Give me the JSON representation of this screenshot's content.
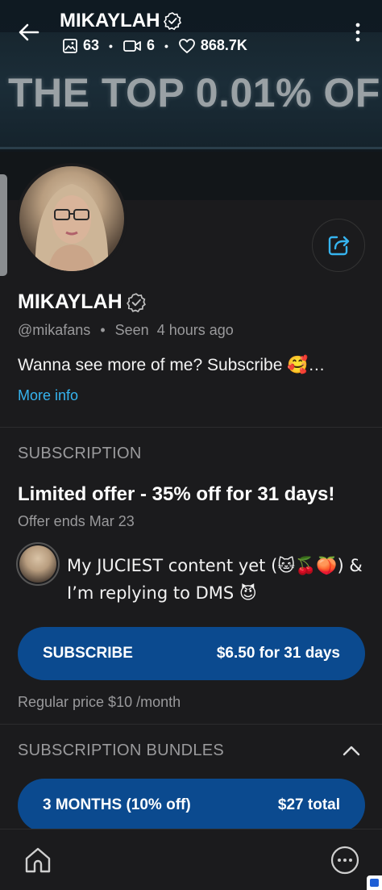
{
  "header": {
    "title": "MIKAYLAH",
    "stats": {
      "photos": "63",
      "videos": "6",
      "likes": "868.7K"
    },
    "cover_text": "THE TOP 0.01% OF"
  },
  "profile": {
    "name": "MIKAYLAH",
    "handle": "@mikafans",
    "seen_label": "Seen",
    "seen_time": "4 hours ago",
    "bio": "Wanna see more of me? Subscribe 🥰…",
    "more_info": "More info"
  },
  "subscription": {
    "section_title": "SUBSCRIPTION",
    "offer_title": "Limited offer - 35% off for 31 days!",
    "offer_ends": "Offer ends Mar 23",
    "message": "My JUCIEST content yet (🐱🍒🍑) & I’m replying to DMS 😈",
    "subscribe_label": "SUBSCRIBE",
    "subscribe_price": "$6.50 for 31 days",
    "regular_price": "Regular price $10 /month"
  },
  "bundles": {
    "section_title": "SUBSCRIPTION BUNDLES",
    "items": [
      {
        "label": "3 MONTHS (10% off)",
        "price": "$27 total"
      }
    ]
  },
  "colors": {
    "accent": "#36b4ef",
    "button": "#0b4a8f",
    "background": "#1b1b1d",
    "muted": "#9a9a9c"
  },
  "icons": [
    "back-arrow-icon",
    "verified-icon",
    "image-icon",
    "video-icon",
    "heart-icon",
    "kebab-menu-icon",
    "share-icon",
    "chevron-up-icon",
    "home-icon",
    "more-icon"
  ]
}
